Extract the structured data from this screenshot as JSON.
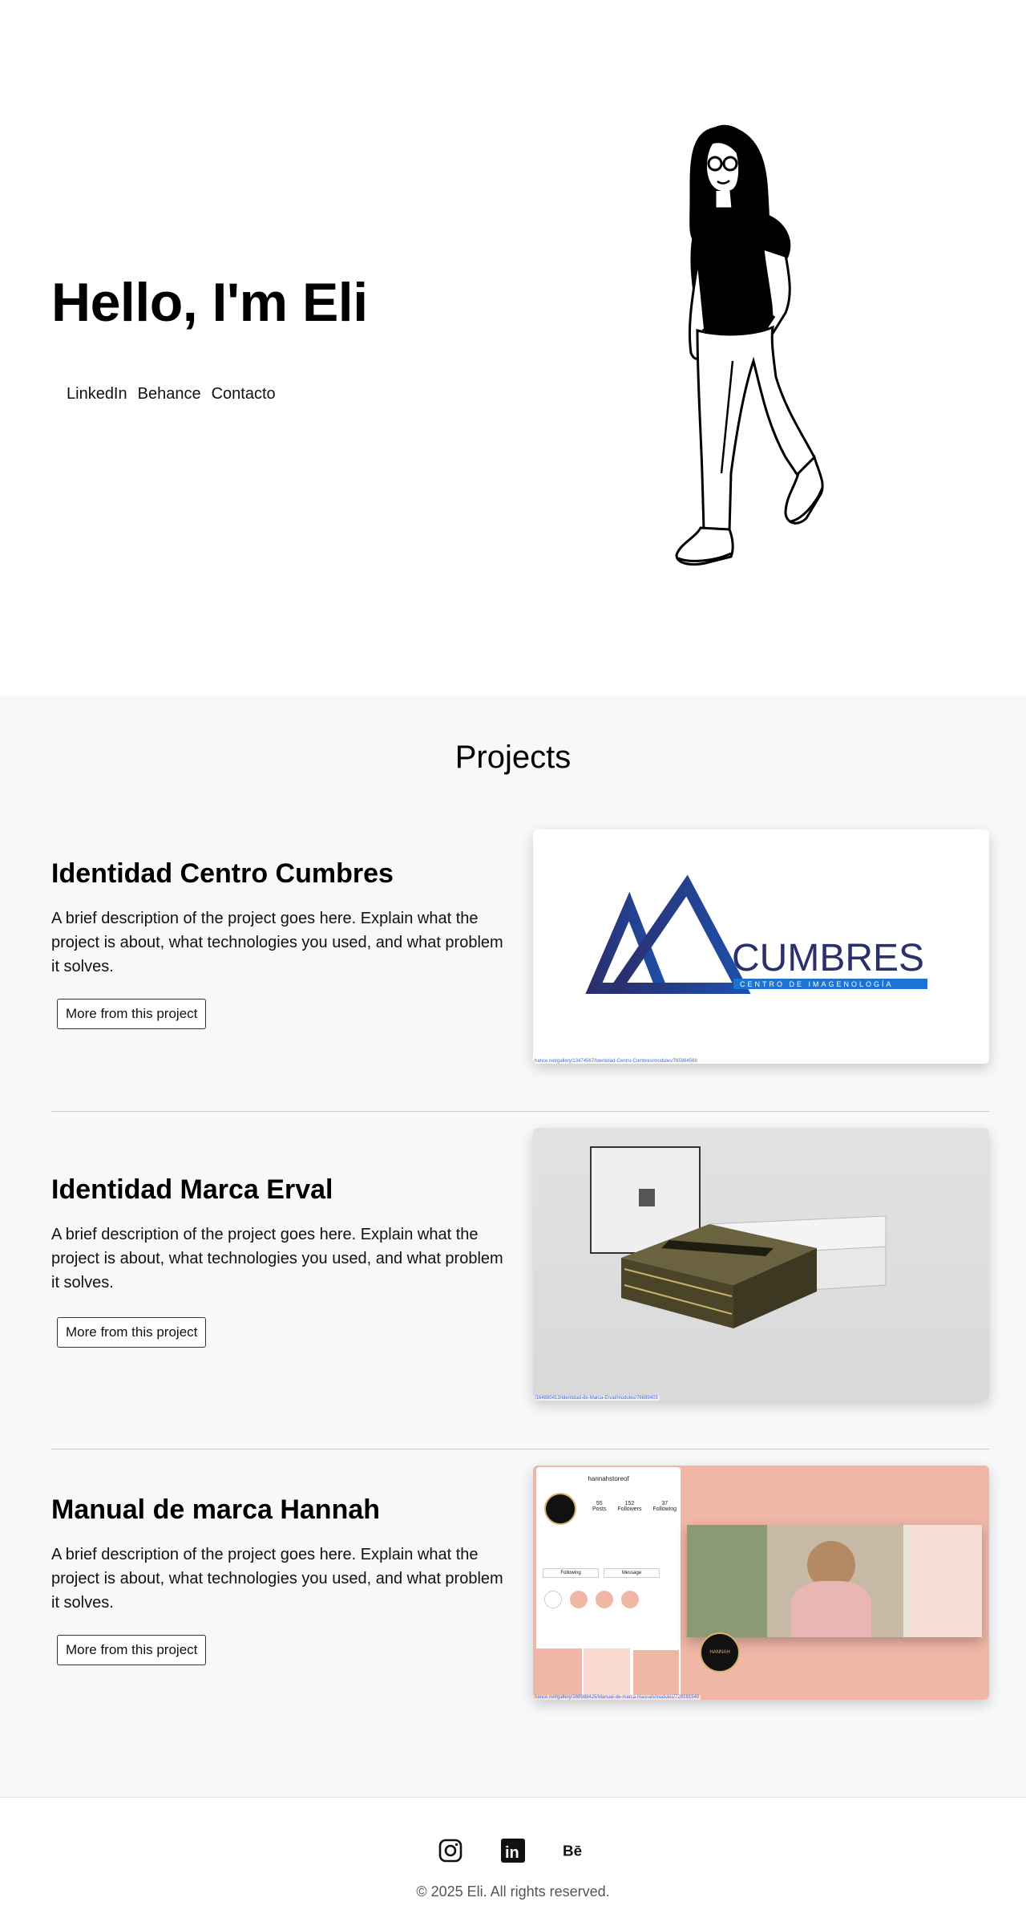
{
  "hero": {
    "title": "Hello, I'm Eli",
    "links": [
      {
        "label": "LinkedIn"
      },
      {
        "label": "Behance"
      },
      {
        "label": "Contacto"
      }
    ]
  },
  "projects": {
    "heading": "Projects",
    "button_label": "More from this project",
    "items": [
      {
        "title": "Identidad Centro Cumbres",
        "description": "A brief description of the project goes here. Explain what the project is about, what technologies you used, and what problem it solves.",
        "thumb_logo_text": "CUMBRES",
        "thumb_logo_subtext": "CENTRO DE IMAGENOLOGÍA",
        "thumb_caption": "hance.net/gallery/13474567/Identidad-Centro-Cumbres/modules/765964569"
      },
      {
        "title": "Identidad Marca Erval",
        "description": "A brief description of the project goes here. Explain what the project is about, what technologies you used, and what problem it solves.",
        "thumb_caption": "/164880413/Identidad-de-Marca-Erval/modules/76689403"
      },
      {
        "title": "Manual de marca Hannah",
        "description": "A brief description of the project goes here. Explain what the project is about, what technologies you used, and what problem it solves.",
        "thumb_profile_name": "hannahstoreof",
        "thumb_stats": [
          {
            "value": "55",
            "label": "Posts"
          },
          {
            "value": "152",
            "label": "Followers"
          },
          {
            "value": "37",
            "label": "Following"
          }
        ],
        "thumb_buttons": [
          "Following",
          "Message"
        ],
        "thumb_brand": "HANNAH",
        "thumb_caption": "hance.net/gallery/168988425/Manual-de-marca-Hannah/modules/728191540"
      }
    ]
  },
  "footer": {
    "icons": [
      "instagram-icon",
      "linkedin-icon",
      "behance-icon"
    ],
    "behance_text": "Bē",
    "linkedin_text": "in",
    "copyright": "© 2025 Eli. All rights reserved."
  },
  "colors": {
    "projects_bg": "#f7f8fa",
    "cumbres_navy": "#2a2f6e",
    "cumbres_blue": "#1d73d1",
    "hannah_pink": "#f0b6a6"
  }
}
